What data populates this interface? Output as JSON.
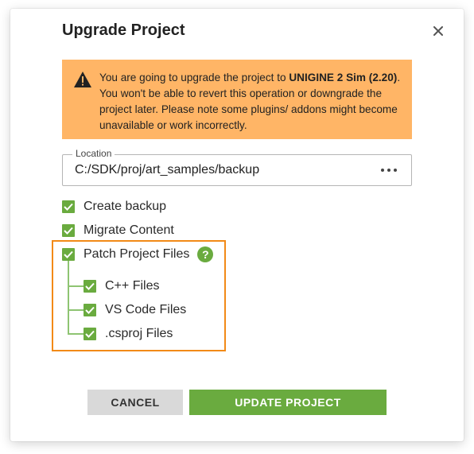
{
  "dialog": {
    "title": "Upgrade Project"
  },
  "warning": {
    "text_prefix": "You are going to upgrade the project to ",
    "version_bold": "UNIGINE 2 Sim (2.20)",
    "text_suffix": ". You won't be able to revert this operation or downgrade the project later. Please note some plugins/ addons might become unavailable or work incorrectly.",
    "icon": "warning-triangle-icon"
  },
  "location": {
    "label": "Location",
    "value": "C:/SDK/proj/art_samples/backup"
  },
  "options": [
    {
      "label": "Create backup",
      "checked": true
    },
    {
      "label": "Migrate Content",
      "checked": true
    },
    {
      "label": "Patch Project Files",
      "checked": true
    }
  ],
  "help_symbol": "?",
  "sub_options": [
    {
      "label": "C++ Files",
      "checked": true
    },
    {
      "label": "VS Code Files",
      "checked": true
    },
    {
      "label": ".csproj Files",
      "checked": true
    }
  ],
  "buttons": {
    "cancel": "CANCEL",
    "update": "UPDATE PROJECT"
  },
  "colors": {
    "accent_green": "#6aab3f",
    "warning_bg": "#ffb566",
    "highlight_orange": "#f28a17"
  }
}
